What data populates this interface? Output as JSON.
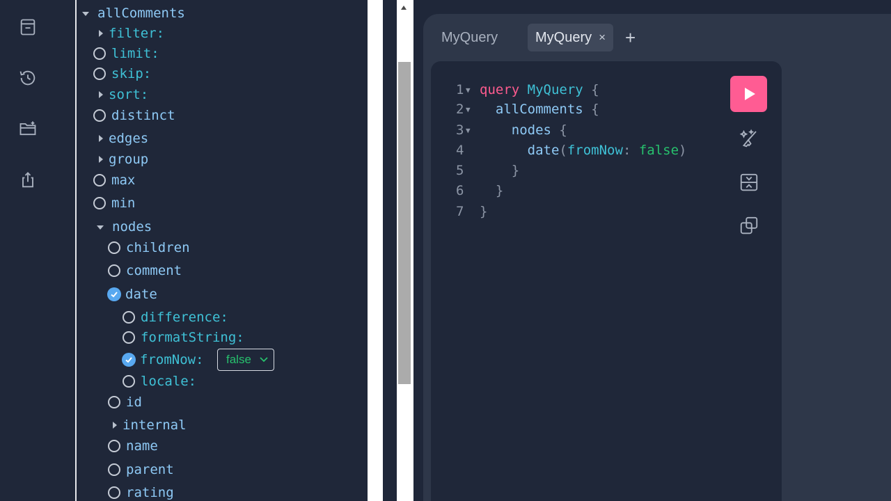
{
  "explorer": {
    "root": "allComments",
    "args": [
      {
        "label": "filter:",
        "kind": "expand"
      },
      {
        "label": "limit:",
        "kind": "radio"
      },
      {
        "label": "skip:",
        "kind": "radio"
      },
      {
        "label": "sort:",
        "kind": "expand"
      }
    ],
    "fields": [
      {
        "label": "distinct",
        "kind": "radio"
      },
      {
        "label": "edges",
        "kind": "expand"
      },
      {
        "label": "group",
        "kind": "expand"
      },
      {
        "label": "max",
        "kind": "radio"
      },
      {
        "label": "min",
        "kind": "radio"
      },
      {
        "label": "nodes",
        "kind": "expanded"
      }
    ],
    "node_fields": [
      {
        "label": "children",
        "kind": "radio"
      },
      {
        "label": "comment",
        "kind": "radio"
      },
      {
        "label": "date",
        "kind": "checked"
      }
    ],
    "date_args": [
      {
        "label": "difference:",
        "kind": "radio"
      },
      {
        "label": "formatString:",
        "kind": "radio"
      },
      {
        "label": "fromNow:",
        "kind": "checked"
      },
      {
        "label": "locale:",
        "kind": "radio"
      }
    ],
    "fromNow_value": "false",
    "more_node_fields": [
      {
        "label": "id",
        "kind": "radio"
      },
      {
        "label": "internal",
        "kind": "expand"
      },
      {
        "label": "name",
        "kind": "radio"
      },
      {
        "label": "parent",
        "kind": "radio"
      },
      {
        "label": "rating",
        "kind": "radio"
      }
    ]
  },
  "tabs": [
    {
      "label": "MyQuery",
      "active": false
    },
    {
      "label": "MyQuery",
      "active": true,
      "close": "×"
    }
  ],
  "add_tab_label": "+",
  "editor": {
    "line_numbers": [
      "1",
      "2",
      "3",
      "4",
      "5",
      "6",
      "7"
    ],
    "tokens": {
      "query_kw": "query",
      "op_name": "MyQuery",
      "brace_open": "{",
      "brace_close": "}",
      "root_field": "allComments",
      "nodes_field": "nodes",
      "date_field": "date",
      "paren_open": "(",
      "paren_close": ")",
      "arg_name": "fromNow",
      "colon": ":",
      "arg_value": "false"
    }
  },
  "icons": {
    "rail": [
      "docs-icon",
      "history-icon",
      "folder-add-icon",
      "share-icon"
    ],
    "toolbar": [
      "run-icon",
      "prettify-icon",
      "merge-icon",
      "copy-icon"
    ]
  },
  "colors": {
    "run_button": "#ff5c93",
    "keyword": "#ff5b8f",
    "field": "#8ec9f5",
    "argument": "#3fc1d6",
    "boolean": "#27c06d",
    "checkbox": "#58a8f0"
  }
}
